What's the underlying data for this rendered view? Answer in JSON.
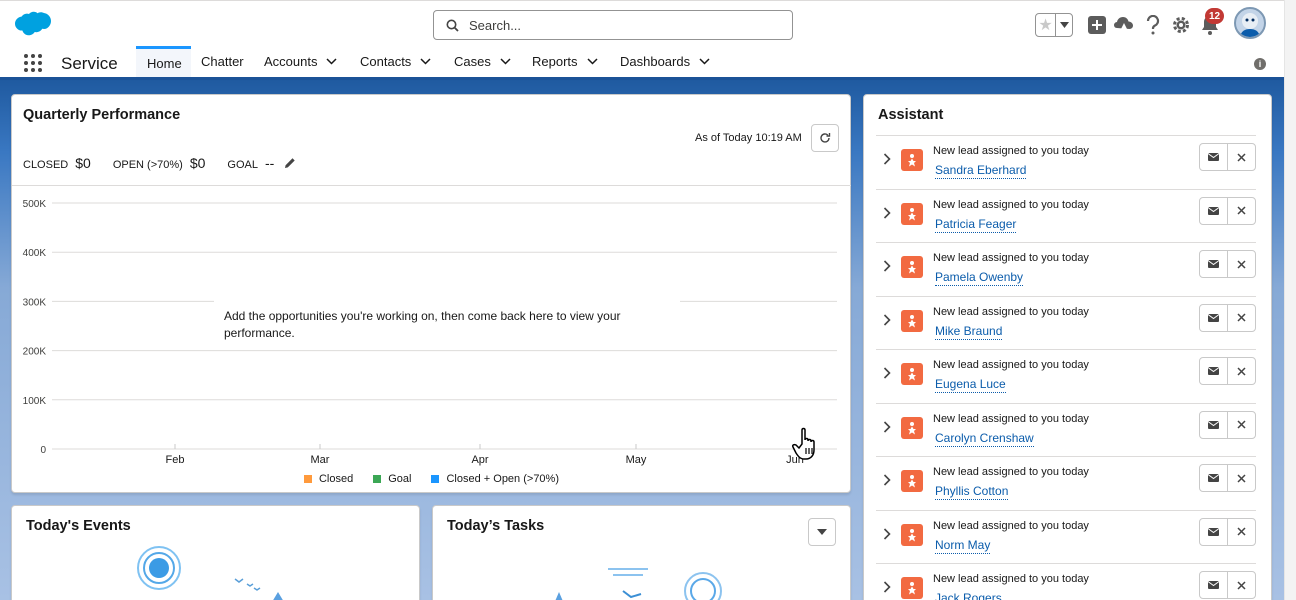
{
  "header": {
    "search_placeholder": "Search...",
    "notification_count": "12"
  },
  "nav": {
    "app_name": "Service",
    "tabs": [
      {
        "label": "Home",
        "active": true,
        "has_menu": false
      },
      {
        "label": "Chatter",
        "active": false,
        "has_menu": false
      },
      {
        "label": "Accounts",
        "active": false,
        "has_menu": true
      },
      {
        "label": "Contacts",
        "active": false,
        "has_menu": true
      },
      {
        "label": "Cases",
        "active": false,
        "has_menu": true
      },
      {
        "label": "Reports",
        "active": false,
        "has_menu": true
      },
      {
        "label": "Dashboards",
        "active": false,
        "has_menu": true
      }
    ]
  },
  "performance": {
    "title": "Quarterly Performance",
    "as_of": "As of Today 10:19 AM",
    "closed_label": "CLOSED",
    "closed_value": "$0",
    "open_label": "OPEN (>70%)",
    "open_value": "$0",
    "goal_label": "GOAL",
    "goal_value": "--",
    "empty_message": "Add the opportunities you're working on, then come back here to view your performance."
  },
  "chart_data": {
    "type": "line",
    "title": "",
    "x_categories": [
      "Feb",
      "Mar",
      "Apr",
      "May",
      "Jun"
    ],
    "y_ticks": [
      "0",
      "100K",
      "200K",
      "300K",
      "400K",
      "500K"
    ],
    "ylim": [
      0,
      500000
    ],
    "series": [
      {
        "name": "Closed",
        "values": [],
        "color": "#ff9a3c"
      },
      {
        "name": "Goal",
        "values": [],
        "color": "#3ba755"
      },
      {
        "name": "Closed + Open (>70%)",
        "values": [],
        "color": "#1b96ff"
      }
    ],
    "legend_position": "bottom",
    "grid": true
  },
  "assistant": {
    "title": "Assistant",
    "items": [
      {
        "message": "New lead assigned to you today",
        "name": "Sandra Eberhard"
      },
      {
        "message": "New lead assigned to you today",
        "name": "Patricia Feager"
      },
      {
        "message": "New lead assigned to you today",
        "name": "Pamela Owenby"
      },
      {
        "message": "New lead assigned to you today",
        "name": "Mike Braund"
      },
      {
        "message": "New lead assigned to you today",
        "name": "Eugena Luce"
      },
      {
        "message": "New lead assigned to you today",
        "name": "Carolyn Crenshaw"
      },
      {
        "message": "New lead assigned to you today",
        "name": "Phyllis Cotton"
      },
      {
        "message": "New lead assigned to you today",
        "name": "Norm May"
      },
      {
        "message": "New lead assigned to you today",
        "name": "Jack Rogers"
      }
    ]
  },
  "events": {
    "title": "Today's Events"
  },
  "tasks": {
    "title": "Today’s Tasks"
  }
}
